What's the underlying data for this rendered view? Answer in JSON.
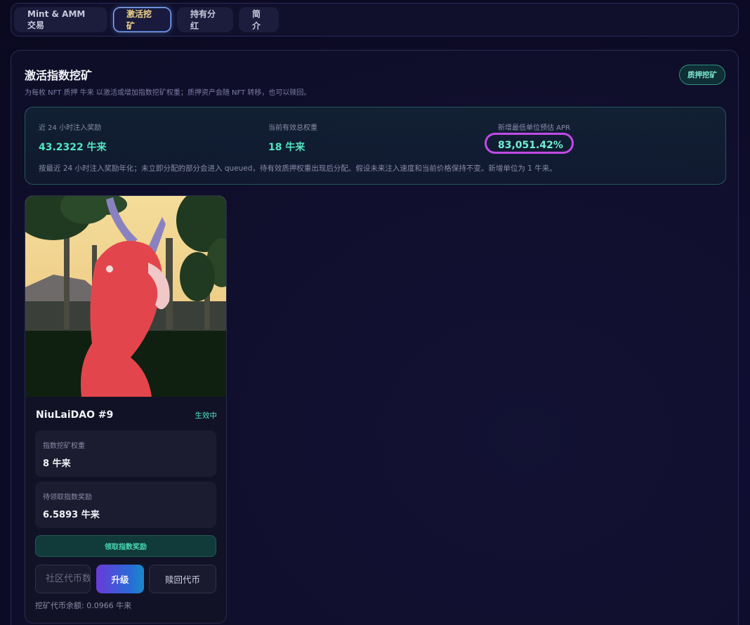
{
  "tabs": [
    {
      "label": "Mint & AMM 交易",
      "active": false
    },
    {
      "label": "激活挖矿",
      "active": true
    },
    {
      "label": "持有分红",
      "active": false
    },
    {
      "label": "简介",
      "active": false
    }
  ],
  "section": {
    "title": "激活指数挖矿",
    "description": "为每枚 NFT 质押 牛来 以激活或增加指数挖矿权重；质押资产会随 NFT 转移，也可以赎回。",
    "stake_button": "质押挖矿"
  },
  "stats": {
    "reward_24h_label": "近 24 小时注入奖励",
    "reward_24h_value": "43.2322 牛来",
    "total_weight_label": "当前有效总权重",
    "total_weight_value": "18 牛来",
    "apr_label": "新增最低单位预估 APR",
    "apr_value": "83,051.42%",
    "note": "按最近 24 小时注入奖励年化；未立即分配的部分会进入 queued，待有效质押权重出现后分配。假设未来注入速度和当前价格保持不变。新增单位为 1 牛来。"
  },
  "card": {
    "name": "NiuLaiDAO #9",
    "status": "生效中",
    "weight_label": "指数挖矿权重",
    "weight_value": "8 牛来",
    "pending_label": "待领取指数奖励",
    "pending_value": "6.5893 牛来",
    "claim_button": "领取指数奖励",
    "community_placeholder": "社区代币数量",
    "upgrade_button": "升级",
    "redeem_button": "赎回代币",
    "balance_text": "挖矿代币余额: 0.0966 牛来"
  },
  "colors": {
    "accent_teal": "#52e6c0",
    "apr_highlight": "#c04ae6",
    "active_tab_text": "#f0d58a"
  }
}
